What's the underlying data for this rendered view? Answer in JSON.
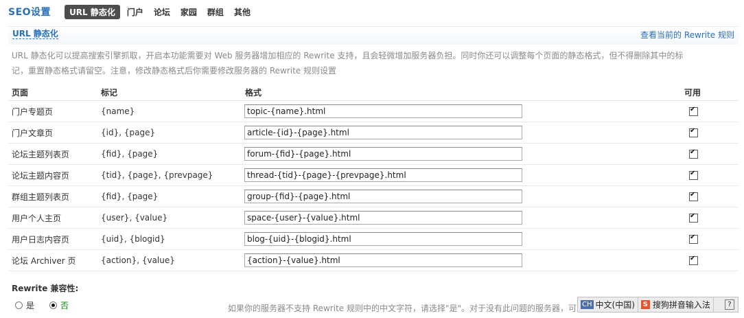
{
  "header": {
    "title": "SEO设置",
    "tabs": [
      {
        "label": "URL 静态化",
        "active": true
      },
      {
        "label": "门户",
        "active": false
      },
      {
        "label": "论坛",
        "active": false
      },
      {
        "label": "家园",
        "active": false
      },
      {
        "label": "群组",
        "active": false
      },
      {
        "label": "其他",
        "active": false
      }
    ]
  },
  "section": {
    "title": "URL 静态化",
    "link": "查看当前的 Rewrite 规则",
    "description": "URL 静态化可以提高搜索引擎抓取，开启本功能需要对 Web 服务器增加相应的 Rewrite 支持，且会轻微增加服务器负担。同时你还可以调整每个页面的静态格式，但不得删除其中的标记，重置静态格式请留空。注意，修改静态格式后你需要修改服务器的 Rewrite 规则设置"
  },
  "table": {
    "headers": [
      "页面",
      "标记",
      "格式",
      "可用"
    ],
    "rows": [
      {
        "page": "门户专题页",
        "marks": "{name}",
        "format": "topic-{name}.html",
        "enabled": true
      },
      {
        "page": "门户文章页",
        "marks": "{id}, {page}",
        "format": "article-{id}-{page}.html",
        "enabled": true
      },
      {
        "page": "论坛主题列表页",
        "marks": "{fid}, {page}",
        "format": "forum-{fid}-{page}.html",
        "enabled": true
      },
      {
        "page": "论坛主题内容页",
        "marks": "{tid}, {page}, {prevpage}",
        "format": "thread-{tid}-{page}-{prevpage}.html",
        "enabled": true
      },
      {
        "page": "群组主题列表页",
        "marks": "{fid}, {page}",
        "format": "group-{fid}-{page}.html",
        "enabled": true
      },
      {
        "page": "用户个人主页",
        "marks": "{user}, {value}",
        "format": "space-{user}-{value}.html",
        "enabled": true
      },
      {
        "page": "用户日志内容页",
        "marks": "{uid}, {blogid}",
        "format": "blog-{uid}-{blogid}.html",
        "enabled": true
      },
      {
        "page": "论坛 Archiver 页",
        "marks": "{action}, {value}",
        "format": "{action}-{value}.html",
        "enabled": true
      }
    ]
  },
  "rewrite": {
    "label": "Rewrite 兼容性:",
    "options": [
      {
        "label": "是",
        "selected": false
      },
      {
        "label": "否",
        "selected": true
      }
    ],
    "hint": "如果你的服务器不支持 Rewrite 规则中的中文字符，请选择\"是\"。对于没有此问题的服务器，可以选择\"否\""
  },
  "ime": {
    "badge": "CH",
    "lang": "中文(中国)",
    "logo": "S",
    "input_method": "搜狗拼音输入法",
    "help": "?"
  }
}
